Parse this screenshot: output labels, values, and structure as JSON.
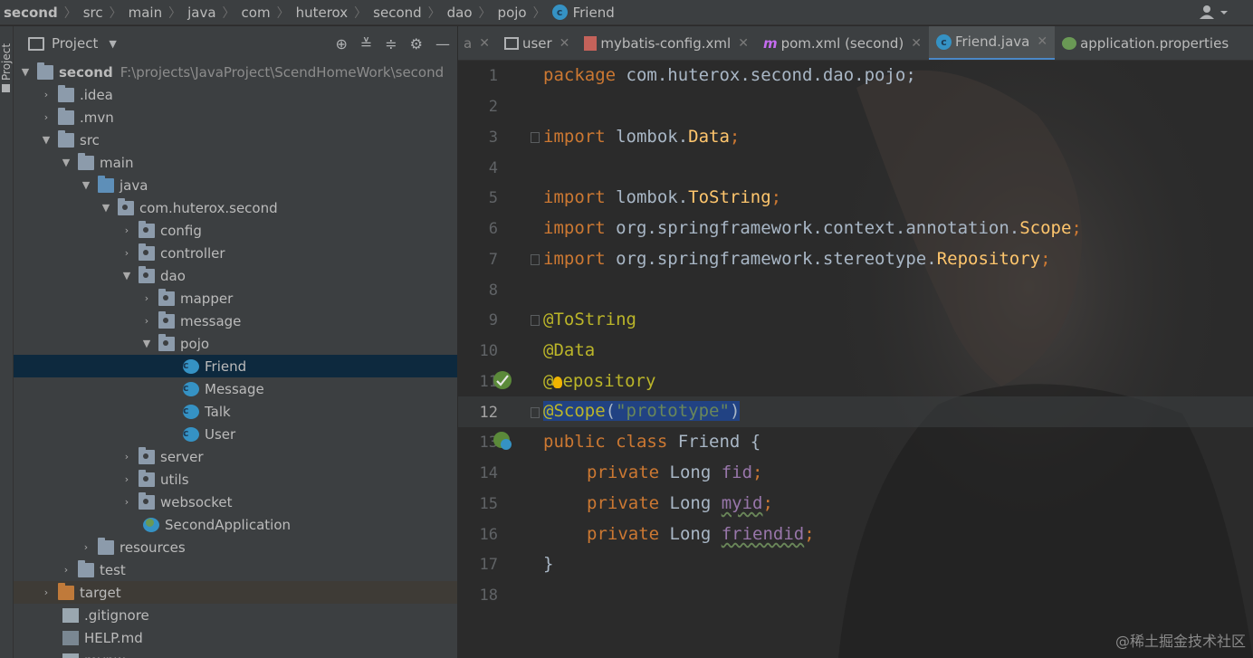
{
  "breadcrumb": [
    "second",
    "src",
    "main",
    "java",
    "com",
    "huterox",
    "second",
    "dao",
    "pojo",
    "Friend"
  ],
  "left_strip_label": "Project",
  "project_panel": {
    "title": "Project",
    "tree": [
      {
        "label": "second",
        "path": "F:\\projects\\JavaProject\\ScendHomeWork\\second"
      },
      {
        "label": ".idea"
      },
      {
        "label": ".mvn"
      },
      {
        "label": "src"
      },
      {
        "label": "main"
      },
      {
        "label": "java"
      },
      {
        "label": "com.huterox.second"
      },
      {
        "label": "config"
      },
      {
        "label": "controller"
      },
      {
        "label": "dao"
      },
      {
        "label": "mapper"
      },
      {
        "label": "message"
      },
      {
        "label": "pojo"
      },
      {
        "label": "Friend"
      },
      {
        "label": "Message"
      },
      {
        "label": "Talk"
      },
      {
        "label": "User"
      },
      {
        "label": "server"
      },
      {
        "label": "utils"
      },
      {
        "label": "websocket"
      },
      {
        "label": "SecondApplication"
      },
      {
        "label": "resources"
      },
      {
        "label": "test"
      },
      {
        "label": "target"
      },
      {
        "label": ".gitignore"
      },
      {
        "label": "HELP.md"
      },
      {
        "label": "mvnw"
      }
    ]
  },
  "tabs": [
    {
      "label": "a"
    },
    {
      "label": "user"
    },
    {
      "label": "mybatis-config.xml"
    },
    {
      "label": "pom.xml (second)"
    },
    {
      "label": "Friend.java"
    },
    {
      "label": "application.properties"
    }
  ],
  "editor": {
    "line_numbers": [
      "1",
      "2",
      "3",
      "4",
      "5",
      "6",
      "7",
      "8",
      "9",
      "10",
      "11",
      "12",
      "13",
      "14",
      "15",
      "16",
      "17",
      "18"
    ],
    "current_line": "12",
    "code": {
      "l1_kw": "package",
      "l1_rest": " com.huterox.second.dao.pojo;",
      "l3_kw": "import",
      "l3_pkg": " lombok.",
      "l3_cls": "Data",
      "l3_end": ";",
      "l5_kw": "import",
      "l5_pkg": " lombok.",
      "l5_cls": "ToString",
      "l5_end": ";",
      "l6_kw": "import",
      "l6_pkg": " org.springframework.context.annotation.",
      "l6_cls": "Scope",
      "l6_end": ";",
      "l7_kw": "import",
      "l7_pkg": " org.springframework.stereotype.",
      "l7_cls": "Repository",
      "l7_end": ";",
      "l9": "@ToString",
      "l10": "@Data",
      "l11_a": "@",
      "l11_b": "epository",
      "l12_ann": "@Scope",
      "l12_open": "(",
      "l12_str": "\"prototype\"",
      "l12_close": ")",
      "l13_kw": "public class",
      "l13_rest": " Friend {",
      "l14_kw": "private",
      "l14_type": " Long ",
      "l14_field": "fid",
      "l14_end": ";",
      "l15_kw": "private",
      "l15_type": " Long ",
      "l15_field": "myid",
      "l15_end": ";",
      "l16_kw": "private",
      "l16_type": " Long ",
      "l16_field": "friendid",
      "l16_end": ";",
      "l17": "}"
    }
  },
  "watermark": "@稀土掘金技术社区",
  "colors": {
    "keyword": "#cc7832",
    "annotation": "#bbb529",
    "string": "#6a8759",
    "field": "#9876aa",
    "selection": "#214283",
    "accent": "#4a88c7"
  }
}
